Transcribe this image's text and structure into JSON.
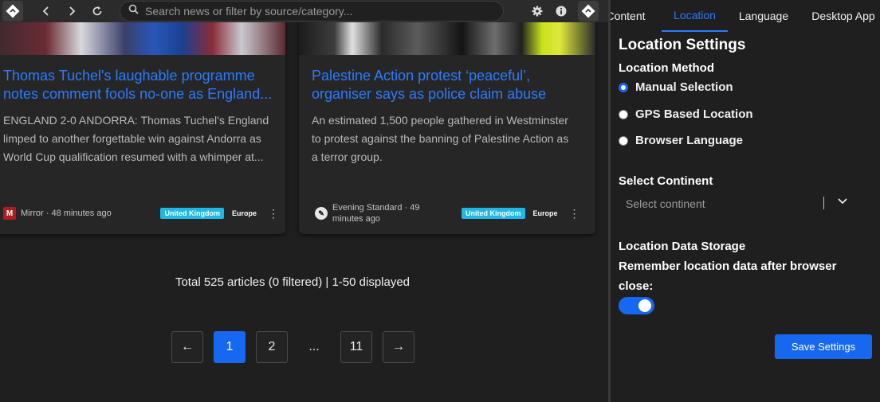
{
  "toolbar": {
    "logo_icon": "app-logo-icon",
    "back_icon": "chevron-left-icon",
    "forward_icon": "chevron-right-icon",
    "reload_icon": "reload-icon",
    "search_placeholder": "Search news or filter by source/category...",
    "settings_icon": "gear-icon",
    "info_icon": "info-icon"
  },
  "articles": [
    {
      "title_line1": "Thomas Tuchel's laughable programme",
      "title_line2": "notes comment fools no-one as England...",
      "desc_line1": "ENGLAND 2-0 ANDORRA: Thomas Tuchel's England",
      "desc_line2": "limped to another forgettable win against Andorra as",
      "desc_line3": "World Cup qualification resumed with a whimper at...",
      "source_icon_letter": "M",
      "source": "Mirror · 48 minutes ago",
      "badge": "United Kingdom",
      "region": "Europe"
    },
    {
      "title_line1": "Palestine Action protest ‘peaceful’,",
      "title_line2": "organiser says as police claim abuse",
      "desc_line1": "An estimated 1,500 people gathered in Westminster",
      "desc_line2": "to protest against the banning of Palestine Action as",
      "desc_line3": "a terror group.",
      "source_icon_letter": "✎",
      "source": "Evening Standard · 49 minutes ago",
      "badge": "United Kingdom",
      "region": "Europe"
    }
  ],
  "summary": "Total 525 articles (0 filtered) | 1-50 displayed",
  "pagination": {
    "prev": "←",
    "pages": [
      "1",
      "2"
    ],
    "ellipsis": "...",
    "last": "11",
    "next": "→",
    "current": "1"
  },
  "settings": {
    "tabs": [
      "Content",
      "Location",
      "Language",
      "Desktop App"
    ],
    "active_tab": "Location",
    "title": "Location Settings",
    "method_heading": "Location Method",
    "methods": [
      "Manual Selection",
      "GPS Based Location",
      "Browser Language"
    ],
    "selected_method": "Manual Selection",
    "continent_heading": "Select Continent",
    "continent_placeholder": "Select continent",
    "storage_heading": "Location Data Storage",
    "storage_desc": "Remember location data after browser close:",
    "storage_enabled": true,
    "save_label": "Save Settings"
  },
  "colors": {
    "accent": "#1668f0",
    "link": "#2b7bff",
    "badge": "#1fb7e6"
  }
}
